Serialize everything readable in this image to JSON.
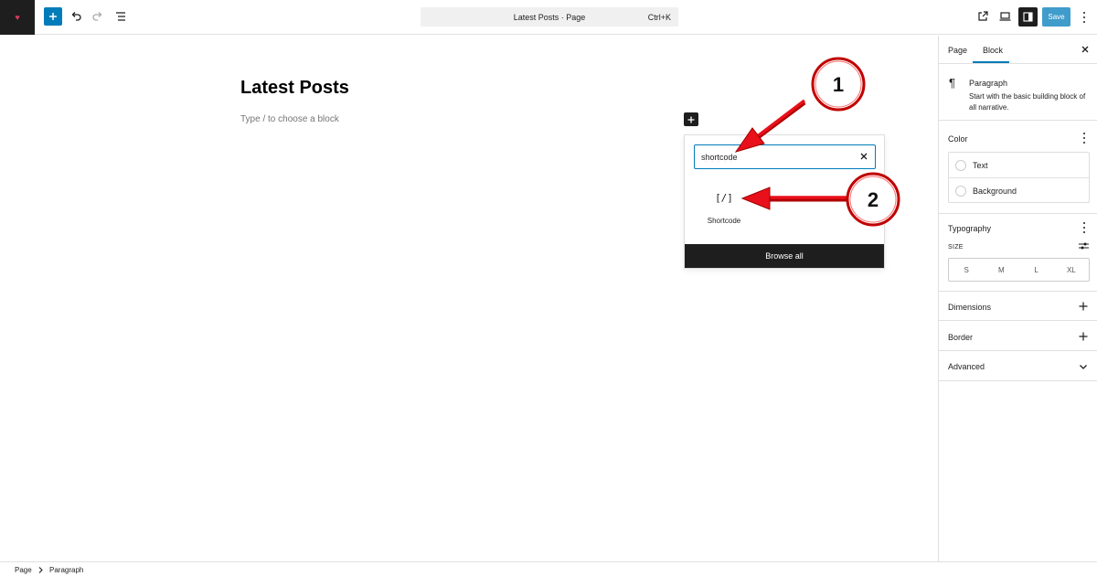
{
  "toolbar": {
    "document_title": "Latest Posts · Page",
    "shortcut": "Ctrl+K",
    "save_label": "Save"
  },
  "canvas": {
    "post_title": "Latest Posts",
    "placeholder": "Type / to choose a block"
  },
  "inserter": {
    "search_value": "shortcode",
    "results": [
      {
        "glyph": "[/]",
        "label": "Shortcode",
        "icon": "shortcode-icon"
      }
    ],
    "browse_all_label": "Browse all"
  },
  "annotations": [
    {
      "number": "1"
    },
    {
      "number": "2"
    }
  ],
  "sidebar": {
    "tabs": [
      {
        "label": "Page"
      },
      {
        "label": "Block"
      }
    ],
    "active_tab": "Block",
    "block": {
      "name": "Paragraph",
      "description": "Start with the basic building block of all narrative."
    },
    "color": {
      "title": "Color",
      "items": [
        {
          "label": "Text"
        },
        {
          "label": "Background"
        }
      ]
    },
    "typography": {
      "title": "Typography",
      "size_label": "SIZE",
      "sizes": [
        "S",
        "M",
        "L",
        "XL"
      ]
    },
    "panels": [
      {
        "label": "Dimensions",
        "icon": "plus-icon"
      },
      {
        "label": "Border",
        "icon": "plus-icon"
      },
      {
        "label": "Advanced",
        "icon": "chevron-down-icon"
      }
    ]
  },
  "breadcrumb": [
    "Page",
    "Paragraph"
  ],
  "colors": {
    "accent": "#007cba",
    "dark": "#1e1e1e",
    "annotation_red": "#e8101a"
  }
}
